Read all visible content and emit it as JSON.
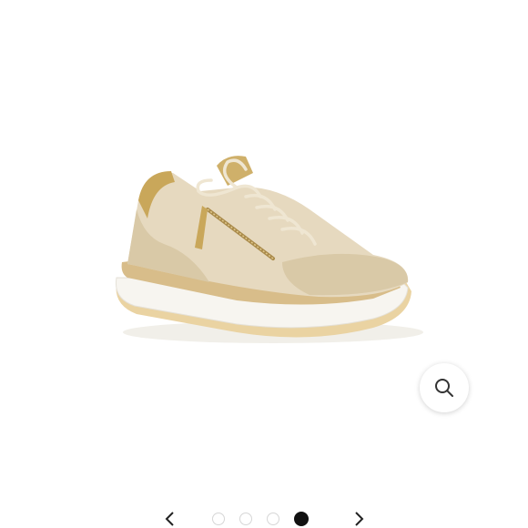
{
  "gallery": {
    "total_images": 4,
    "active_index": 3
  },
  "icons": {
    "zoom": "magnifier-icon",
    "prev": "chevron-left-icon",
    "next": "chevron-right-icon"
  },
  "colors": {
    "shoe_suede": "#d9c9a7",
    "shoe_leather": "#e8dcc4",
    "shoe_gold": "#c9a75a",
    "sole_white": "#f7f5f0",
    "sole_gum": "#ead3a2",
    "active_dot": "#111111",
    "inactive_dot_border": "#d6d6d6"
  }
}
